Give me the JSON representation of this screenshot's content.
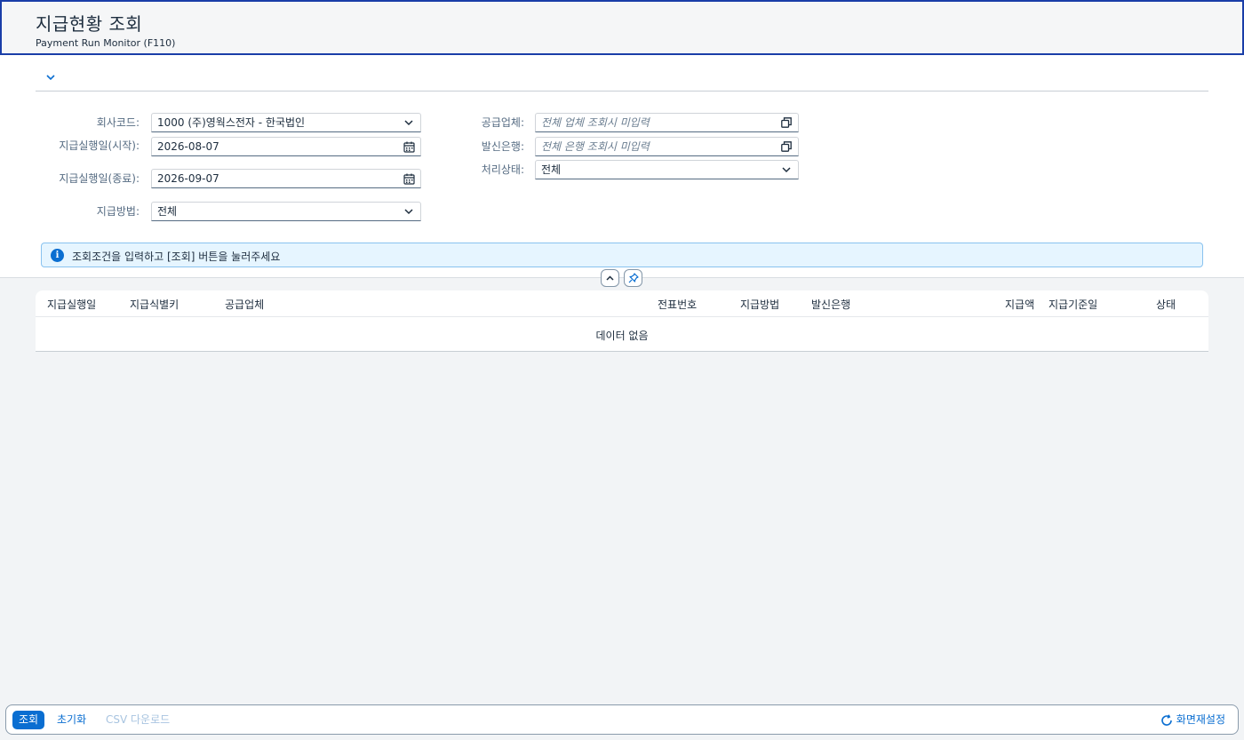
{
  "header": {
    "title": "지급현황 조회",
    "subtitle": "Payment Run Monitor (F110)"
  },
  "filters": {
    "company_code": {
      "label": "회사코드:",
      "value": "1000 (주)영웍스전자 - 한국법인"
    },
    "pay_date_from": {
      "label": "지급실행일(시작):",
      "value": "2026-08-07"
    },
    "pay_date_to": {
      "label": "지급실행일(종료):",
      "value": "2026-09-07"
    },
    "pay_method": {
      "label": "지급방법:",
      "value": "전체"
    },
    "vendor": {
      "label": "공급업체:",
      "placeholder": "전체 업체 조회시 미입력"
    },
    "house_bank": {
      "label": "발신은행:",
      "placeholder": "전체 은행 조회시 미입력"
    },
    "status": {
      "label": "처리상태:",
      "value": "전체"
    }
  },
  "info": {
    "message": "조회조건을 입력하고 [조회] 버튼을 눌러주세요"
  },
  "table": {
    "columns": [
      "지급실행일",
      "지급식별키",
      "공급업체",
      "전표번호",
      "지급방법",
      "발신은행",
      "지급액",
      "지급기준일",
      "상태"
    ],
    "empty_text": "데이터 없음"
  },
  "footer": {
    "search_label": "조회",
    "reset_label": "초기화",
    "csv_label": "CSV 다운로드",
    "screen_reset_label": "화면재설정"
  },
  "colors": {
    "accent": "#0a6ed1",
    "header_border": "#1a3ea8",
    "info_bg": "#e6f5ff"
  },
  "icons": {
    "collapse": "chevron-down-icon",
    "dropdown": "chevron-down-icon",
    "calendar": "calendar-icon",
    "value_help": "value-help-icon",
    "info": "info-icon",
    "collapse_header": "chevron-up-icon",
    "pin": "pin-icon",
    "refresh": "refresh-icon"
  }
}
